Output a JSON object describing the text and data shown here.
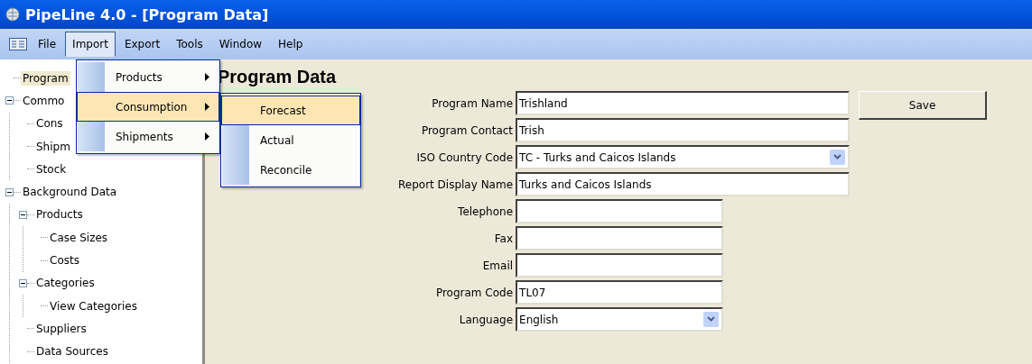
{
  "window": {
    "title": "PipeLine 4.0 - [Program Data]"
  },
  "menubar": [
    {
      "label": "File",
      "selected": false
    },
    {
      "label": "Import",
      "selected": true
    },
    {
      "label": "Export",
      "selected": false
    },
    {
      "label": "Tools",
      "selected": false
    },
    {
      "label": "Window",
      "selected": false
    },
    {
      "label": "Help",
      "selected": false
    }
  ],
  "import_menu": [
    {
      "label": "Products",
      "selected": false,
      "has_submenu": true
    },
    {
      "label": "Consumption",
      "selected": true,
      "has_submenu": true
    },
    {
      "label": "Shipments",
      "selected": false,
      "has_submenu": true
    }
  ],
  "consumption_submenu": [
    {
      "label": "Forecast",
      "selected": true
    },
    {
      "label": "Actual",
      "selected": false
    },
    {
      "label": "Reconcile",
      "selected": false
    }
  ],
  "tree": [
    {
      "label": "Program",
      "selected": true
    },
    {
      "label": "Commo",
      "selected": false,
      "expanded": true,
      "children": [
        {
          "label": "Cons",
          "selected": false
        },
        {
          "label": "Shipm",
          "selected": false
        },
        {
          "label": "Stock",
          "selected": false
        }
      ]
    },
    {
      "label": "Background Data",
      "selected": false,
      "expanded": true,
      "children": [
        {
          "label": "Products",
          "selected": false,
          "expanded": true,
          "children": [
            {
              "label": "Case Sizes",
              "selected": false
            },
            {
              "label": "Costs",
              "selected": false
            }
          ]
        },
        {
          "label": "Categories",
          "selected": false,
          "expanded": true,
          "children": [
            {
              "label": "View Categories",
              "selected": false
            }
          ]
        },
        {
          "label": "Suppliers",
          "selected": false
        },
        {
          "label": "Data Sources",
          "selected": false
        }
      ]
    }
  ],
  "heading": "Program Data",
  "fields": [
    {
      "label": "Program Name",
      "kind": "text",
      "value": "Trishland"
    },
    {
      "label": "Program Contact",
      "kind": "text",
      "value": "Trish"
    },
    {
      "label": "ISO Country Code",
      "kind": "dropdown",
      "value": "TC - Turks and Caicos Islands"
    },
    {
      "label": "Report Display Name",
      "kind": "text",
      "value": "Turks and Caicos Islands"
    },
    {
      "label": "Telephone",
      "kind": "text"
    },
    {
      "label": "Fax",
      "kind": "text"
    },
    {
      "label": "Email",
      "kind": "text"
    },
    {
      "label": "Program Code",
      "kind": "text",
      "value": "TL07"
    },
    {
      "label": "Language",
      "kind": "dropdown",
      "value": "English"
    }
  ],
  "save_button": {
    "label": "Save"
  }
}
